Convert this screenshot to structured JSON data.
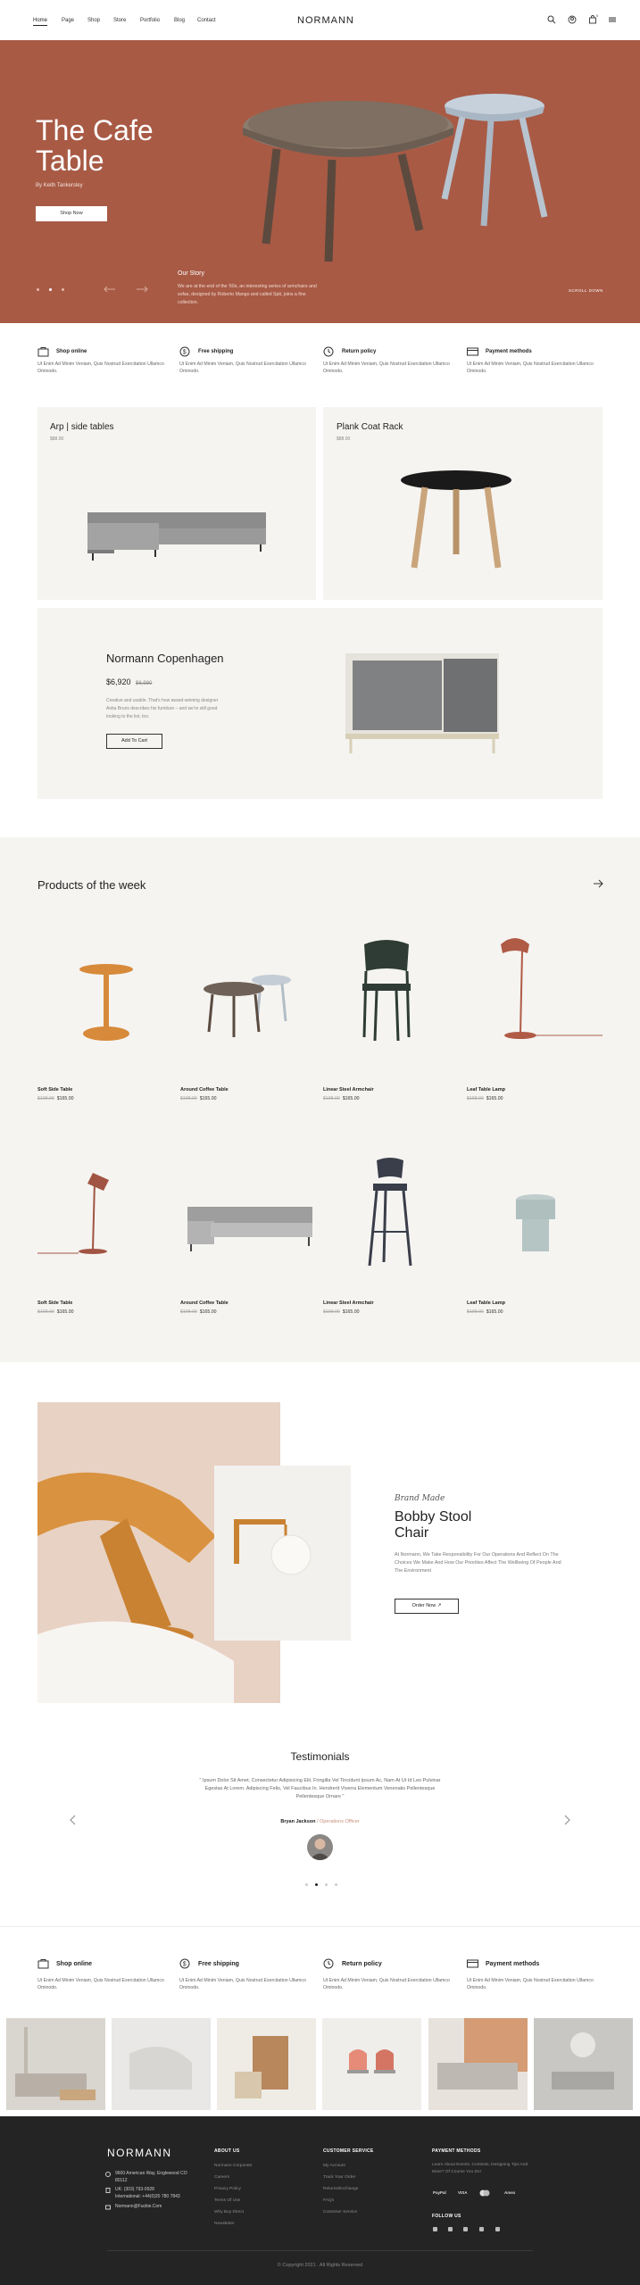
{
  "header": {
    "nav": [
      "Home",
      "Page",
      "Shop",
      "Store",
      "Portfolio",
      "Blog",
      "Contact"
    ],
    "logo": "NORMANN",
    "icons": [
      "search-icon",
      "user-icon",
      "cart-icon",
      "menu-icon"
    ],
    "cart_count": "0"
  },
  "hero": {
    "title": "The Cafe Table",
    "byline": "By Keith Tankersley",
    "button": "Shop Now",
    "story_heading": "Our Story",
    "story_text": "We are at the end of the '60s, an interesting series of armchairs and sofas, designed by Roberto Mango and called Spit, joins a fine collection.",
    "scroll_label": "SCROLL DOWN",
    "background": "#a85a45"
  },
  "features": [
    {
      "icon": "bag-icon",
      "title": "Shop online",
      "text": "Ut Enim Ad Minim Veniam, Quis Nostrud Exercitation Ullamco Ominodo."
    },
    {
      "icon": "dollar-icon",
      "title": "Free shipping",
      "text": "Ut Enim Ad Minim Veniam, Quis Nostrud Exercitation Ullamco Ominodo."
    },
    {
      "icon": "clock-icon",
      "title": "Return policy",
      "text": "Ut Enim Ad Minim Veniam, Quis Nostrud Exercitation Ullamco Ominodo."
    },
    {
      "icon": "card-icon",
      "title": "Payment methods",
      "text": "Ut Enim Ad Minim Veniam, Quis Nostrud Exercitation Ullamco Ominodo."
    }
  ],
  "tiles": {
    "arp": {
      "title": "Arp | side tables",
      "price": "$88.00"
    },
    "plank": {
      "title": "Plank Coat Rack",
      "price": "$88.00"
    },
    "normann": {
      "title": "Normann Copenhagen",
      "price": "$6,920",
      "old_price": "$6,980",
      "text": "Creative and usable. That's how award-winning designer Anita Bruns describes his furniture – and we're still good looking to the list, too.",
      "button": "Add To Cart"
    }
  },
  "week": {
    "title": "Products of the week",
    "products": [
      {
        "name": "Soft Side Table",
        "old": "$198.00",
        "price": "$165.00"
      },
      {
        "name": "Around Coffee Table",
        "old": "$198.00",
        "price": "$165.00"
      },
      {
        "name": "Linear Steel Armchair",
        "old": "$198.00",
        "price": "$165.00"
      },
      {
        "name": "Leaf Table Lamp",
        "old": "$198.00",
        "price": "$165.00"
      },
      {
        "name": "Soft Side Table",
        "old": "$198.00",
        "price": "$165.00"
      },
      {
        "name": "Around Coffee Table",
        "old": "$198.00",
        "price": "$165.00"
      },
      {
        "name": "Linear Steel Armchair",
        "old": "$198.00",
        "price": "$165.00"
      },
      {
        "name": "Leaf Table Lamp",
        "old": "$198.00",
        "price": "$165.00"
      }
    ]
  },
  "promo": {
    "script": "Brand Made",
    "title": "Bobby Stool Chair",
    "text": "At Normann, We Take Responsibility For Our Operations And Reflect On The Choices We Make And How Our Priorities Affect The Wellbeing Of People And The Environment",
    "button": "Order Now"
  },
  "testimonials": {
    "title": "Testimonials",
    "quote": "\" Ipsum Dolor Sit Amet, Consectetur Adipisicing Elit. Fringilla Vel Tincidunt Ipsum Ac, Nam At Ut Id Leo Pulvinar Egestas At Lorem. Adipiscing Felis, Vel Faucibus In. Hendrerit Viverra Elementum Venenatis Pellentesque Pellentesque Ornare \"",
    "author": "Bryan Jackson",
    "role": "/ Operations Officer"
  },
  "footer": {
    "logo": "NORMANN",
    "address": "9600 American Way, Englewood CO 80112",
    "phone": "UK: (303) 793-0928",
    "intl": "International: +44(0)20 780 7843",
    "email": "Normann@Fuckie.Com",
    "about_heading": "ABOUT US",
    "about_links": [
      "Normann Corporate",
      "Careers",
      "Privacy Policy",
      "Terms Of Use",
      "Why Buy Direct",
      "Newsletter"
    ],
    "cs_heading": "CUSTOMER SERVICE",
    "cs_links": [
      "My Account",
      "Track Your Order",
      "Returns/Exchange",
      "FAQs",
      "Customer Service"
    ],
    "pay_heading": "PAYMENT METHODS",
    "pay_text": "Learn About Events, Contests, Designing Tips And More? Of Course You Do!",
    "pay_logos": [
      "PayPal",
      "VISA",
      "MC",
      "Amex"
    ],
    "follow": "FOLLOW US",
    "copyright": "© Copyright 2021 . All Rights Reserved"
  }
}
